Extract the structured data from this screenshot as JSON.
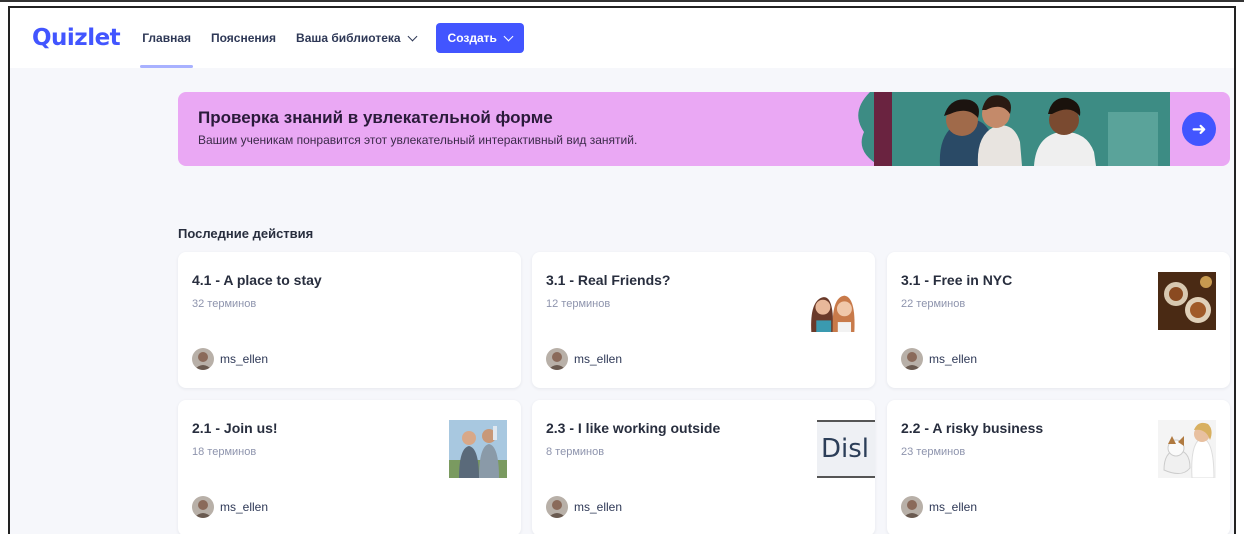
{
  "nav": {
    "logo": "Quizlet",
    "links": [
      {
        "label": "Главная",
        "active": true
      },
      {
        "label": "Пояснения",
        "active": false
      },
      {
        "label": "Ваша библиотека",
        "active": false
      }
    ],
    "create_label": "Создать"
  },
  "banner": {
    "title": "Проверка знаний в увлекательной форме",
    "subtitle": "Вашим ученикам понравится этот увлекательный интерактивный вид занятий.",
    "arrow_icon": "arrow-right-icon"
  },
  "recent": {
    "title": "Последние действия",
    "cards": [
      {
        "title": "4.1 - A place to stay",
        "count": "32 терминов",
        "user": "ms_ellen",
        "thumb": "none"
      },
      {
        "title": "3.1 - Real Friends?",
        "count": "12 терминов",
        "user": "ms_ellen",
        "thumb": "friends-photo"
      },
      {
        "title": "3.1 - Free in NYC",
        "count": "22 терминов",
        "user": "ms_ellen",
        "thumb": "food-photo"
      },
      {
        "title": "2.1 - Join us!",
        "count": "18 терминов",
        "user": "ms_ellen",
        "thumb": "runners-photo"
      },
      {
        "title": "2.3 - I like working outside",
        "count": "8 терминов",
        "user": "ms_ellen",
        "thumb": "text-image",
        "thumb_text": "Disl"
      },
      {
        "title": "2.2 - A risky business",
        "count": "23 терминов",
        "user": "ms_ellen",
        "thumb": "vet-dog-photo"
      }
    ]
  },
  "colors": {
    "brand": "#4255ff",
    "banner_bg": "#eaa8f4",
    "page_bg": "#f6f7fb"
  }
}
